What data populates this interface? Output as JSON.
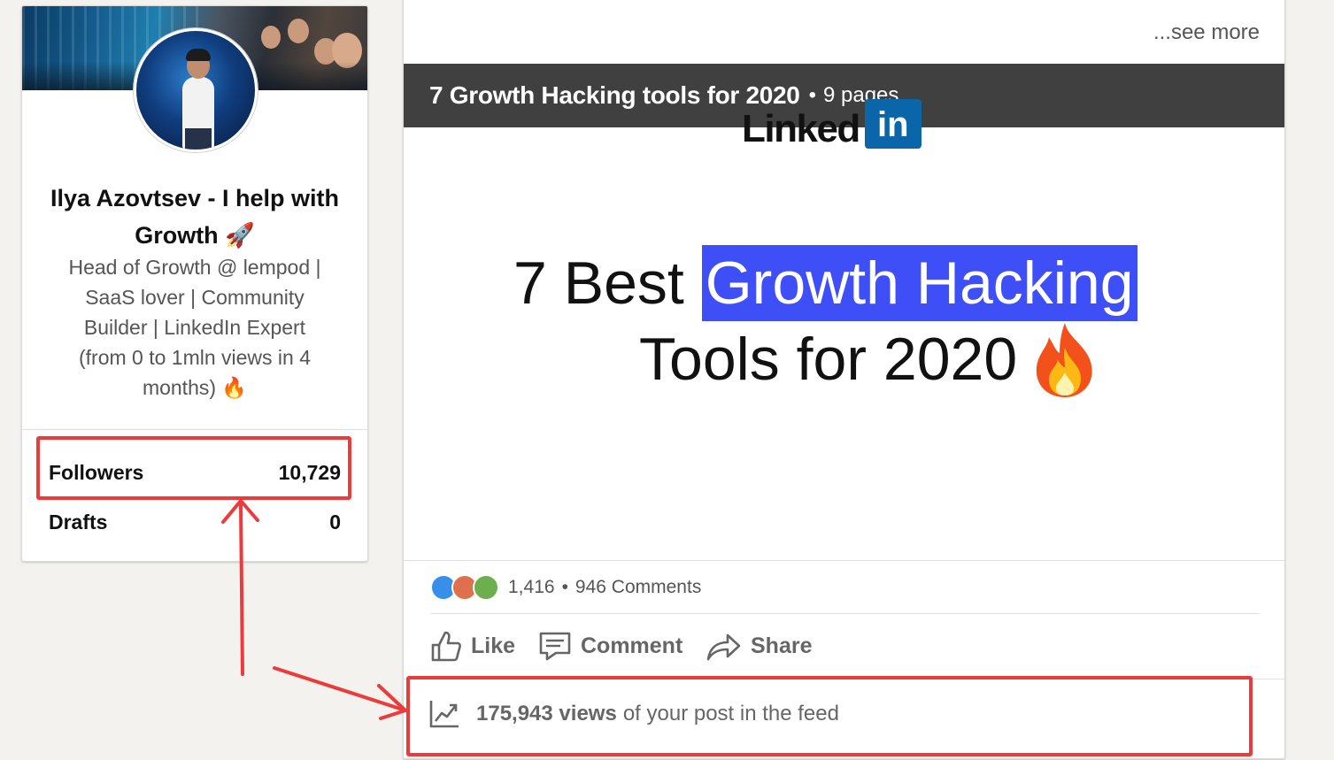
{
  "profile": {
    "name": "Ilya Azovtsev - I help with Growth 🚀",
    "headline": "Head of Growth @ lempod | SaaS lover | Community Builder | LinkedIn Expert (from 0 to 1mln views in 4 months) 🔥",
    "stats": [
      {
        "label": "Followers",
        "value": "10,729"
      },
      {
        "label": "Drafts",
        "value": "0"
      }
    ]
  },
  "post": {
    "see_more": "...see more",
    "document": {
      "title": "7 Growth Hacking tools for 2020",
      "separator": "•",
      "pages": "9 pages"
    },
    "slide": {
      "logo_word": "Linked",
      "logo_box": "in",
      "line1_plain": "7 Best",
      "line1_highlight": "Growth Hacking",
      "line2": "Tools for 2020"
    },
    "social": {
      "reaction_count": "1,416",
      "separator": "•",
      "comments": "946 Comments"
    },
    "actions": {
      "like": "Like",
      "comment": "Comment",
      "share": "Share"
    },
    "views": {
      "count": "175,943 views",
      "suffix": "of your post in the feed"
    }
  },
  "colors": {
    "highlight": "#3e4ff7",
    "annotation": "#ec3b3b",
    "linkedin_blue": "#0a66a8",
    "doc_header": "#404040"
  },
  "icons": [
    "like-icon",
    "comment-icon",
    "share-icon",
    "analytics-icon",
    "rocket-icon",
    "fire-icon",
    "linkedin-logo"
  ]
}
